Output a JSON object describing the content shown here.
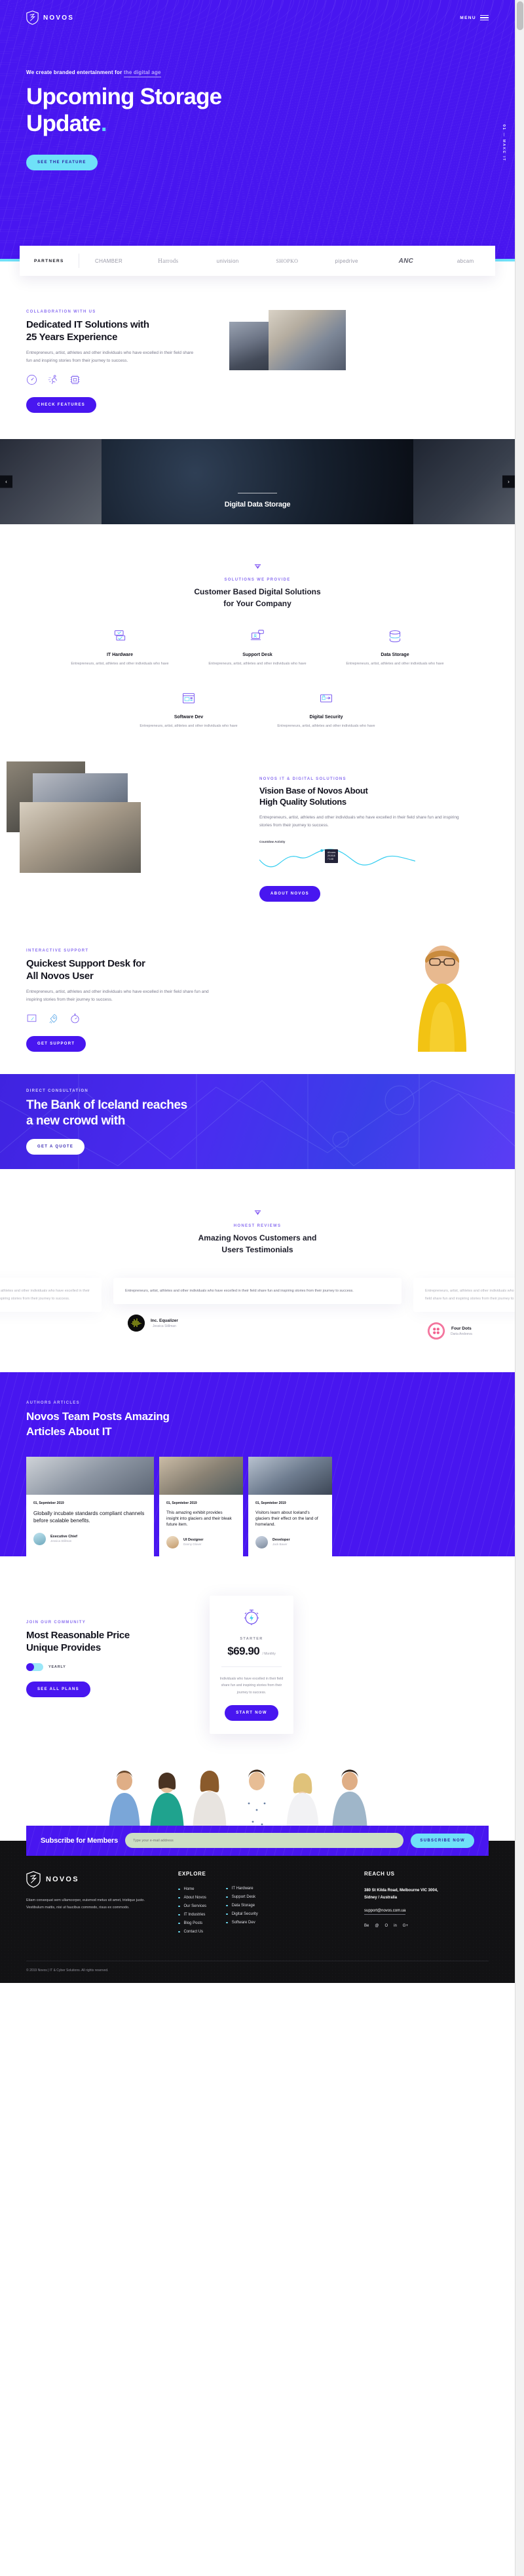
{
  "brand": {
    "name": "NOVOS",
    "logo_icon": "shield-logo-icon"
  },
  "header": {
    "menu_label": "MENU",
    "menu_icon": "hamburger-icon"
  },
  "hero": {
    "eyebrow_plain": "We create branded entertainment for ",
    "eyebrow_highlight": "the digital age",
    "title_line1": "Upcoming Storage",
    "title_line2": "Update",
    "title_dot": ".",
    "cta": "SEE THE FEATURE",
    "side_label_active": "01",
    "side_label_rest": " — MAKE IT"
  },
  "partners": {
    "first_label": "PARTNERS",
    "items": [
      "CHAMBER",
      "Harrods",
      "univision",
      "SHOPKO",
      "pipedrive",
      "ANC",
      "abcam"
    ]
  },
  "dedicated": {
    "kicker": "COLLABORATION WITH US",
    "title_line1": "Dedicated IT Solutions with",
    "title_line2": "25 Years Experience",
    "body": "Entrepreneurs, artist, athletes and other individuals who have excelled in their field share fun and inspiring stories from their journey to success.",
    "icons": [
      "gauge-icon",
      "running-icon",
      "chip-icon"
    ],
    "cta": "CHECK FEATURES",
    "image_a": "office-people-photo",
    "image_b": "office-desk-photo"
  },
  "slider": {
    "prev_icon": "chevron-left-icon",
    "next_icon": "chevron-right-icon",
    "caption": "Digital Data Storage",
    "slides": [
      "developer-left-photo",
      "developer-glasses-photo",
      "developer-right-photo"
    ]
  },
  "solutions": {
    "diamond_icon": "diamond-icon",
    "kicker": "SOLUTIONS WE PROVIDE",
    "title_line1": "Customer Based Digital Solutions",
    "title_line2": "for Your Company",
    "cards": [
      {
        "icon": "it-hardware-icon",
        "title": "IT Hardware",
        "body": "Entrepreneurs, artist, athletes and other individuals who have"
      },
      {
        "icon": "support-desk-icon",
        "title": "Support Desk",
        "body": "Entrepreneurs, artist, athletes and other individuals who have"
      },
      {
        "icon": "data-storage-icon",
        "title": "Data Storage",
        "body": "Entrepreneurs, artist, athletes and other individuals who have"
      },
      {
        "icon": "software-dev-icon",
        "title": "Software Dev",
        "body": "Entrepreneurs, artist, athletes and other individuals who have"
      },
      {
        "icon": "digital-security-icon",
        "title": "Digital Security",
        "body": "Entrepreneurs, artist, athletes and other individuals who have"
      }
    ]
  },
  "vision": {
    "kicker": "NOVOS IT & DIGITAL SOLUTIONS",
    "title_line1": "Vision Base of Novos About",
    "title_line2": "High Quality Solutions",
    "body": "Entrepreneurs, artist, athletes and other individuals who have excelled in their field share fun and inspiring stories from their journey to success.",
    "cta": "ABOUT NOVOS",
    "chart_label": "Countdow Activity",
    "tooltip_l1": "All users",
    "tooltip_l2": "29   2018",
    "tooltip_l3": "7     1:48"
  },
  "chart_data": {
    "type": "line",
    "title": "Countdow Activity",
    "x": [
      0,
      1,
      2,
      3,
      4,
      5,
      6,
      7,
      8,
      9,
      10
    ],
    "series": [
      {
        "name": "Activity",
        "values": [
          34,
          20,
          38,
          26,
          50,
          64,
          40,
          22,
          44,
          58,
          46
        ]
      }
    ],
    "xlabel": "",
    "ylabel": "",
    "ylim": [
      0,
      80
    ],
    "grid": false,
    "legend": "none",
    "annotation": "All users 29 2018 / 7 1:48"
  },
  "support": {
    "kicker": "INTERACTIVE SUPPORT",
    "title_line1": "Quickest Support Desk for",
    "title_line2": "All Novos User",
    "body": "Entrepreneurs, artist, athletes and other individuals who have excelled in their field share fun and inspiring stories from their journey to success.",
    "icons": [
      "dashboard-icon",
      "rocket-icon",
      "stopwatch-icon"
    ],
    "cta": "GET SUPPORT",
    "person_image": "woman-yellow-sweater-photo"
  },
  "bank": {
    "kicker": "DIRECT CONSULTATION",
    "title_line1": "The Bank of Iceland reaches",
    "title_line2": "a new crowd with",
    "cta": "GET A QUOTE"
  },
  "testimonials": {
    "diamond_icon": "diamond-icon",
    "kicker": "HONEST REVIEWS",
    "title_line1": "Amazing Novos Customers and",
    "title_line2": "Users Testimonials",
    "quote": "Entrepreneurs, artist, athletes and other individuals who have excelled in their field share fun and inspiring stories from their journey to success.",
    "items": [
      {
        "company": "Inc. Equalizer",
        "person": "Jessica Stillman",
        "avatar": "equalizer-logo"
      },
      {
        "company": "Four Dots",
        "person": "Daria Andeeva",
        "avatar": "four-dots-logo"
      }
    ]
  },
  "blog": {
    "kicker": "AUTHORS ARTICLES",
    "title_line1": "Novos Team Posts Amazing",
    "title_line2": "Articles About IT",
    "posts": [
      {
        "date": "01, Sepmteber 2019",
        "title": "Globally incubate standards compliant channels before scalable benefits.",
        "author_role": "Executive Chief",
        "author_name": "Jessica Stillman",
        "thumb": "coworking-space-photo"
      },
      {
        "date": "01, Sepmteber 2019",
        "title": "This amazing exhibit provides insight into glaciers and their bleak future item.",
        "author_role": "UI Designer",
        "author_name": "Danny Glover",
        "thumb": "cafe-table-photo"
      },
      {
        "date": "01, Sepmteber 2019",
        "title": "Visitors learn about Iceland's glaciers their effect on the land of homeland.",
        "author_role": "Developer",
        "author_name": "Jack Bauer",
        "thumb": "team-meeting-photo"
      }
    ]
  },
  "pricing": {
    "kicker": "JOIN OUR COMMUNITY",
    "title_line1": "Most Reasonable Price",
    "title_line2": "Unique Provides",
    "toggle_label": "YEARLY",
    "cta": "SEE ALL PLANS",
    "plan": {
      "icon": "stopwatch-bolt-icon",
      "name": "STARTER",
      "price": "$69.90",
      "period": "/ Monthly",
      "desc": "Individuals who have excelled in their field share fun and inspiring stories from their journey to success.",
      "cta": "START NOW"
    }
  },
  "team_band": {
    "image": "team-group-photo"
  },
  "subscribe": {
    "title": "Subscribe for Members",
    "placeholder": "Type your e-mail address",
    "cta": "SUBSCRIBE NOW",
    "value": ""
  },
  "footer": {
    "brand_name": "NOVOS",
    "about": "Etiam consequat sem ullamcorper, euismod metus sit amet, tristique justo. Vestibulum mattis, nisi ut faucibus commodo, risus ex commodo.",
    "explore_heading": "EXPLORE",
    "explore_links": [
      "Home",
      "About Novos",
      "Our Services",
      "IT Industries",
      "Blog Posts",
      "Contact Us"
    ],
    "service_links": [
      "IT Hardware",
      "Support Desk",
      "Data Storage",
      "Digital Security",
      "Software Dev"
    ],
    "reach_heading": "REACH US",
    "address_line1": "380 St Kilda Road, Melbourne VIC 3004,",
    "address_line2": "Sidney / Australia",
    "email": "support@novos.com.ua",
    "social": [
      "Be",
      "@",
      "O",
      "in",
      "G+"
    ],
    "copyright": "© 2019 Novos | IT & Cyber Solutions. All rights reserved."
  },
  "colors": {
    "primary": "#4816f0",
    "cyan": "#6fe1f8",
    "dark": "#121214",
    "muted": "#8d8d9c"
  }
}
